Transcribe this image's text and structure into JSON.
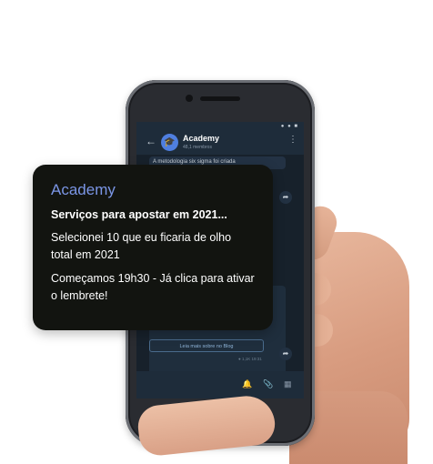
{
  "notification": {
    "title": "Academy",
    "headline": "Serviços para apostar em 2021...",
    "line1": "Selecionei 10 que eu ficaria de olho total em 2021",
    "line2": "Começamos 19h30 - Já clica para ativar o lembrete!",
    "accent_color": "#7b96e6",
    "background_color": "#121410"
  },
  "phone_chat": {
    "status_dots": "● ● ■",
    "title": "Academy",
    "subtitle": "48,1 membros",
    "preview_text": "A metodologia six sigma foi criada",
    "blog_button_label": "Leia mais sobre no Blog",
    "meta_text": "● 1,1K  19:31",
    "icons": [
      "back-arrow-icon",
      "graduation-cap-icon",
      "kebab-menu-icon",
      "share-icon",
      "bell-icon",
      "paperclip-icon",
      "keyboard-icon"
    ]
  }
}
